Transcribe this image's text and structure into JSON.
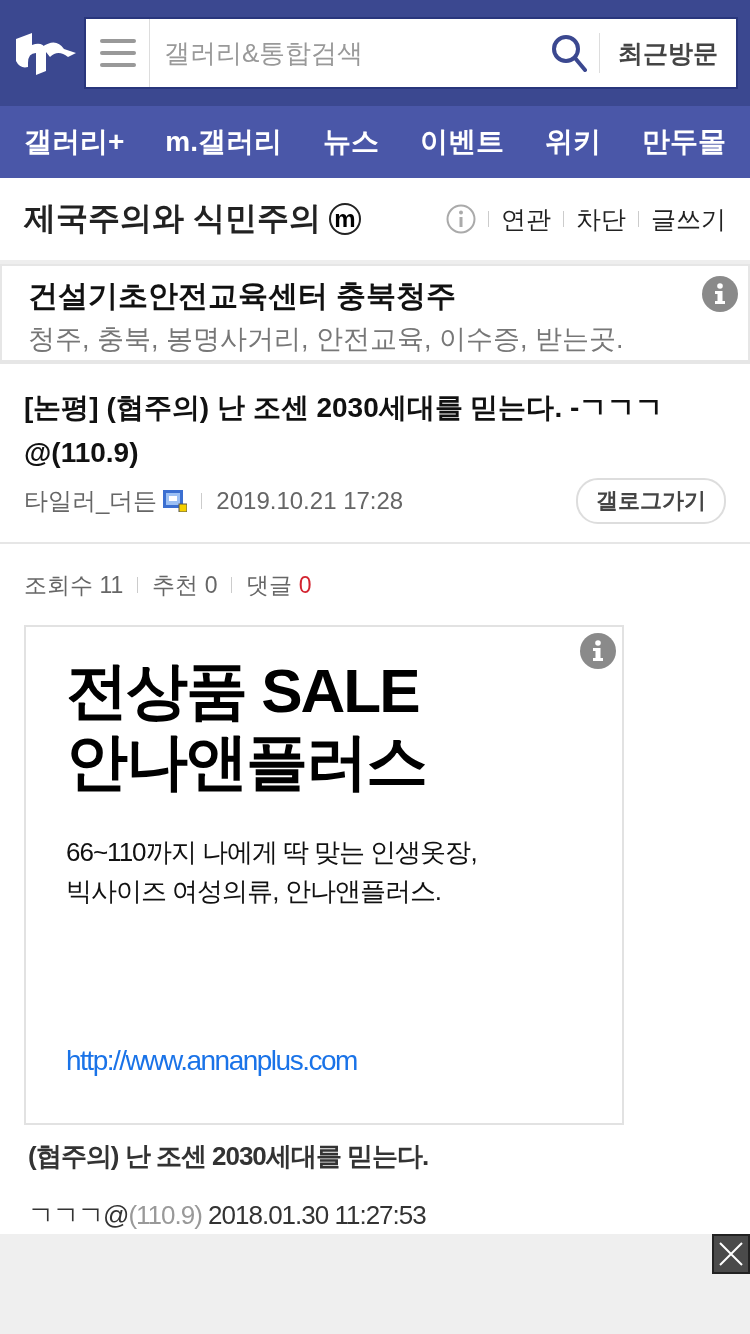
{
  "header": {
    "search": {
      "placeholder": "갤러리&통합검색"
    },
    "recent_button": "최근방문"
  },
  "nav": {
    "items": [
      "갤러리+",
      "m.갤러리",
      "뉴스",
      "이벤트",
      "위키",
      "만두몰"
    ]
  },
  "gallery": {
    "title": "제국주의와 식민주의",
    "badge": "m",
    "links": [
      "연관",
      "차단",
      "글쓰기"
    ]
  },
  "ad_box": {
    "title": "건설기초안전교육센터 충북청주",
    "keywords": "청주, 충북, 봉명사거리, 안전교육, 이수증, 받는곳."
  },
  "post": {
    "title": "[논평] (협주의) 난 조센 2030세대를 믿는다. -ㄱㄱㄱ@(110.9)",
    "author": "타일러_더든",
    "date": "2019.10.21 17:28",
    "gallog_button": "갤로그가기",
    "stats": [
      {
        "label": "조회수",
        "value": "11",
        "kind": "plain"
      },
      {
        "label": "추천",
        "value": "0",
        "kind": "plain"
      },
      {
        "label": "댓글",
        "value": "0",
        "kind": "alert"
      }
    ]
  },
  "banner": {
    "headline": [
      "전상품 SALE",
      "안나앤플러스"
    ],
    "description": [
      "66~110까지 나에게 딱 맞는 인생옷장,",
      "빅사이즈 여성의류, 안나앤플러스."
    ],
    "url": "http://www.annanplus.com"
  },
  "content": {
    "heading": "(협주의) 난 조센 2030세대를 믿는다.",
    "signature": {
      "name": "ㄱㄱㄱ@",
      "ip": "(110.9)",
      "date": "2018.01.30 11:27:53"
    }
  }
}
